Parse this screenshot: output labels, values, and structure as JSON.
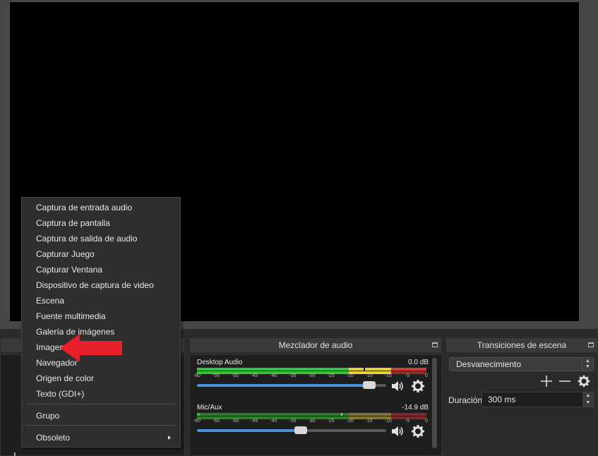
{
  "docks": {
    "mixer_title": "Mezclador de audio",
    "transitions_title": "Transiciones de escena"
  },
  "mixer": {
    "channels": [
      {
        "name": "Desktop Audio",
        "db": "0.0 dB",
        "volume": 0.94
      },
      {
        "name": "Mic/Aux",
        "db": "-14.9 dB",
        "volume": 0.55
      }
    ],
    "scale": [
      "-60",
      "-55",
      "-50",
      "-45",
      "-40",
      "-35",
      "-30",
      "-25",
      "-20",
      "-15",
      "-10",
      "-5",
      "0"
    ],
    "icons": [
      "speaker-icon",
      "gear-icon"
    ]
  },
  "transitions": {
    "selected": "Desvanecimiento",
    "duration_label": "Duración",
    "duration_value": "300 ms"
  },
  "context_menu": {
    "items": [
      "Captura de entrada audio",
      "Captura de pantalla",
      "Captura de salida de audio",
      "Capturar Juego",
      "Capturar Ventana",
      "Dispositivo de captura de video",
      "Escena",
      "Fuente multimedia",
      "Galería de imágenes",
      "Imagen",
      "Navegador",
      "Origen de color",
      "Texto (GDI+)"
    ],
    "group": "Grupo",
    "deprecated": "Obsoleto",
    "highlighted_item": "Imagen"
  },
  "colors": {
    "meter_green": "#37c23a",
    "meter_yellow": "#e6d23a",
    "meter_red": "#d03c3c",
    "slider_blue": "#4a90d9",
    "arrow_red": "#e8202a"
  }
}
